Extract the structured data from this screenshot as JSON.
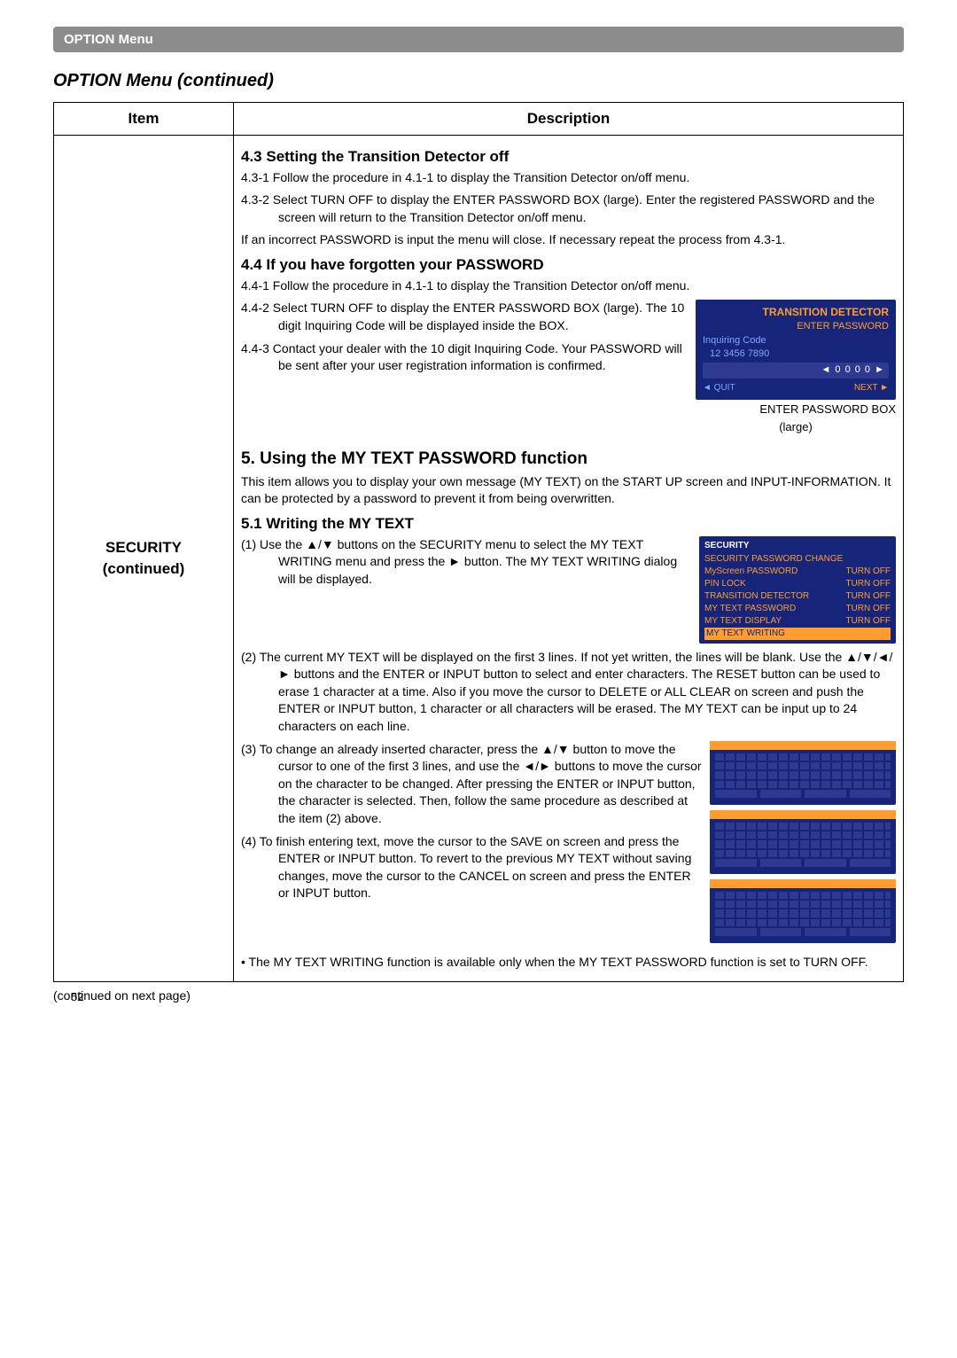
{
  "banner": "OPTION Menu",
  "page_title": "OPTION Menu (continued)",
  "table": {
    "header_item": "Item",
    "header_desc": "Description",
    "item_label_line1": "SECURITY",
    "item_label_line2": "(continued)"
  },
  "desc": {
    "h43": "4.3 Setting the Transition Detector off",
    "p431": "4.3-1 Follow the procedure in 4.1-1 to display the Transition Detector on/off menu.",
    "p432": "4.3-2 Select TURN OFF to display the ENTER PASSWORD BOX (large). Enter the registered PASSWORD and the screen will return to the Transition Detector on/off menu.",
    "p43note": "If an incorrect PASSWORD is input the menu will close. If necessary repeat the process from 4.3-1.",
    "h44": "4.4 If you have forgotten your PASSWORD",
    "p441": "4.4-1 Follow the procedure in 4.1-1 to display the Transition Detector on/off menu.",
    "p442": "4.4-2 Select TURN OFF to display the ENTER PASSWORD BOX (large). The 10 digit Inquiring Code will be displayed inside the BOX.",
    "p443": "4.4-3 Contact your dealer with the 10 digit Inquiring Code. Your PASSWORD will be sent after your user registration information is confirmed.",
    "h5": "5. Using the MY TEXT PASSWORD function",
    "p5intro": "This item allows you to display your own message (MY TEXT) on the START UP screen and INPUT-INFORMATION. It can be protected by a password to prevent it from being overwritten.",
    "h51": "5.1 Writing the MY TEXT",
    "p511": "(1) Use the ▲/▼ buttons on the SECURITY menu to select the MY TEXT WRITING menu and press the ► button. The MY TEXT WRITING dialog will be displayed.",
    "p512": "(2) The current MY TEXT will be displayed on the first 3 lines. If not yet written, the lines will be blank. Use the ▲/▼/◄/► buttons and the ENTER or INPUT button to select and enter characters. The RESET button can be used to erase 1 character at a time. Also if you move the cursor to DELETE or ALL CLEAR on screen and push the ENTER or INPUT button, 1 character or all characters will be erased. The MY TEXT can be input up to 24 characters on each line.",
    "p513": "(3) To change an already inserted character, press the ▲/▼ button to move the cursor to one of the first 3 lines, and use the ◄/► buttons to move the cursor on the character to be changed. After pressing the ENTER or INPUT button, the character is selected. Then, follow the same procedure as described at the item (2) above.",
    "p514": "(4) To finish entering text, move the cursor to the SAVE on screen and press the ENTER or INPUT button. To revert to the previous MY TEXT without saving changes, move the cursor to the CANCEL on screen and press the ENTER or INPUT button.",
    "note": "• The MY TEXT WRITING function is available only when the MY TEXT PASSWORD function is set to TURN OFF."
  },
  "osd_large": {
    "title": "TRANSITION DETECTOR",
    "sub": "ENTER PASSWORD",
    "inq_label": "Inquiring Code",
    "inq_code": "12 3456 7890",
    "digits": "◄ 0 0 0 0 ►",
    "quit": "◄ QUIT",
    "next": "NEXT ►",
    "caption1": "ENTER PASSWORD BOX",
    "caption2": "(large)"
  },
  "sec_menu": {
    "hdr": "SECURITY",
    "r1l": "SECURITY PASSWORD CHANGE",
    "r1r": "",
    "r2l": "MyScreen PASSWORD",
    "r2r": "TURN OFF",
    "r3l": "PIN LOCK",
    "r3r": "TURN OFF",
    "r4l": "TRANSITION DETECTOR",
    "r4r": "TURN OFF",
    "r5l": "MY TEXT PASSWORD",
    "r5r": "TURN OFF",
    "r6l": "MY TEXT DISPLAY",
    "r6r": "TURN OFF",
    "r7l": "MY TEXT WRITING",
    "r7r": ""
  },
  "footer": {
    "cont": "(continued on next page)",
    "page": "52"
  }
}
